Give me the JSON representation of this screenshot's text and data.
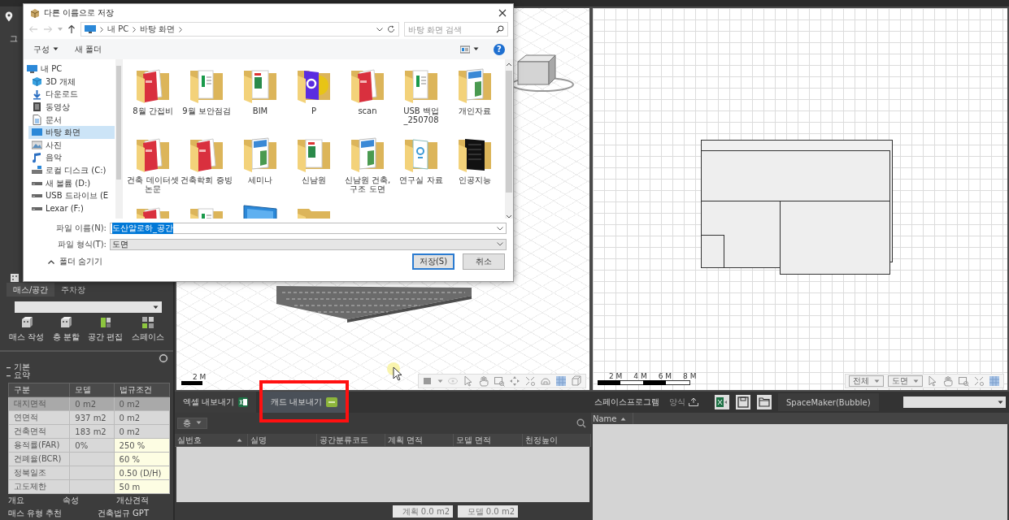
{
  "left_panel": {
    "header_text": "그",
    "mass_tabs": [
      {
        "label": "매스/공간",
        "selected": true
      },
      {
        "label": "주차장",
        "selected": false
      }
    ],
    "tools": [
      {
        "label": "매스 작성",
        "kind": "mass"
      },
      {
        "label": "층 분할",
        "kind": "mass"
      },
      {
        "label": "공간 편집",
        "kind": "edit"
      },
      {
        "label": "스페이스",
        "kind": "grid"
      }
    ],
    "sections": [
      "기본",
      "요약"
    ],
    "summary": {
      "columns": [
        "구분",
        "모델",
        "법규조건"
      ],
      "rows": [
        {
          "label": "대지면적",
          "model": "0 m2",
          "limit": "0 m2",
          "selected": true,
          "limit_editable": false
        },
        {
          "label": "연면적",
          "model": "937 m2",
          "limit": "0 m2",
          "selected": false,
          "limit_editable": false
        },
        {
          "label": "건축면적",
          "model": "183 m2",
          "limit": "0 m2",
          "selected": false,
          "limit_editable": false
        },
        {
          "label": "용적률(FAR)",
          "model": "0%",
          "limit": "250 %",
          "selected": false,
          "limit_editable": true
        },
        {
          "label": "건폐율(BCR)",
          "limit": "60 %",
          "selected": false,
          "limit_editable": true
        },
        {
          "label": "정북일조",
          "limit": "0.50 (D/H)",
          "selected": false,
          "limit_editable": true
        },
        {
          "label": "고도제한",
          "limit": "50 m",
          "selected": false,
          "limit_editable": true
        }
      ]
    },
    "bottom_tabs": [
      [
        "개요",
        "속성",
        "개산견적"
      ],
      [
        "매스 유형 추천",
        "건축법규 GPT"
      ]
    ]
  },
  "center_viewport": {
    "scale_label": "2 M"
  },
  "export_panel": {
    "tabs": [
      {
        "label": "엑셀 내보내기",
        "kind": "excel",
        "selected": false,
        "highlighted": false
      },
      {
        "label": "캐드 내보내기",
        "kind": "dwg",
        "selected": true,
        "highlighted": true
      }
    ],
    "floor_filter": "층",
    "columns": [
      {
        "label": "실번호",
        "sorted": true
      },
      {
        "label": "실명",
        "sorted": false
      },
      {
        "label": "공간분류코드",
        "sorted": false
      },
      {
        "label": "계획 면적",
        "sorted": false
      },
      {
        "label": "모델 면적",
        "sorted": false
      },
      {
        "label": "천정높이",
        "sorted": false
      }
    ],
    "totals": [
      "계획 0.0 m2",
      "모델 0.0 m2"
    ]
  },
  "right_viewport": {
    "scale_labels": [
      "2 M",
      "4 M",
      "6 M",
      "8 M"
    ],
    "view_selects": [
      "전체",
      "도면"
    ]
  },
  "space_panel": {
    "title": "스페이스프로그램",
    "form_label": "양식",
    "mode": "SpaceMaker(Bubble)",
    "columns": [
      {
        "label": "Name",
        "sorted": true
      }
    ]
  },
  "dialog": {
    "title": "다른 이름으로 저장",
    "path": [
      "내 PC",
      "바탕 화면"
    ],
    "search_placeholder": "바탕 화면 검색",
    "toolbar": [
      "구성",
      "새 폴더"
    ],
    "help_label": "?",
    "nav": [
      {
        "label": "내 PC",
        "kind": "pc",
        "selected": false,
        "children": [
          {
            "label": "3D 개체",
            "kind": "cube",
            "selected": false
          },
          {
            "label": "다운로드",
            "kind": "download",
            "selected": false
          },
          {
            "label": "동영상",
            "kind": "video",
            "selected": false
          },
          {
            "label": "문서",
            "kind": "doc",
            "selected": false
          },
          {
            "label": "바탕 화면",
            "kind": "desktop",
            "selected": true
          },
          {
            "label": "사진",
            "kind": "image",
            "selected": false
          },
          {
            "label": "음악",
            "kind": "music",
            "selected": false
          },
          {
            "label": "로컬 디스크 (C:)",
            "kind": "system",
            "selected": false
          },
          {
            "label": "새 볼륨 (D:)",
            "kind": "drive",
            "selected": false
          },
          {
            "label": "USB 드라이브 (E",
            "kind": "drive",
            "selected": false
          },
          {
            "label": "Lexar (F:)",
            "kind": "drive",
            "selected": false
          }
        ]
      }
    ],
    "files": [
      {
        "name": "8월 간접비",
        "kind": "pdf"
      },
      {
        "name": "9월 보안점검",
        "kind": "docs"
      },
      {
        "name": "BIM",
        "kind": "bim"
      },
      {
        "name": "P",
        "kind": "app"
      },
      {
        "name": "scan",
        "kind": "pdf"
      },
      {
        "name": "USB 백업 _250708",
        "kind": "docs"
      },
      {
        "name": "개인자료",
        "kind": "blue"
      },
      {
        "name": "건축 데이터셋 논문",
        "kind": "pdf"
      },
      {
        "name": "건축학회 증빙",
        "kind": "pdf"
      },
      {
        "name": "세미나",
        "kind": "blue"
      },
      {
        "name": "신남원",
        "kind": "bim"
      },
      {
        "name": "신남원 건축, 구조 도면",
        "kind": "blue"
      },
      {
        "name": "연구실 자료",
        "kind": "han"
      },
      {
        "name": "인공지능",
        "kind": "dark"
      },
      {
        "kind": "pdf"
      },
      {
        "kind": "docs"
      },
      {
        "kind": "monitor"
      },
      {
        "kind": "plain"
      }
    ],
    "filename": {
      "label": "파일 이름(N):",
      "value": "도산알로하_공간",
      "text_selected": true
    },
    "filetype": {
      "label": "파일 형식(T):",
      "value": "도면"
    },
    "hide_folders": "폴더 숨기기",
    "buttons": [
      {
        "label": "저장(S)",
        "default": true
      },
      {
        "label": "취소",
        "default": false
      }
    ]
  }
}
